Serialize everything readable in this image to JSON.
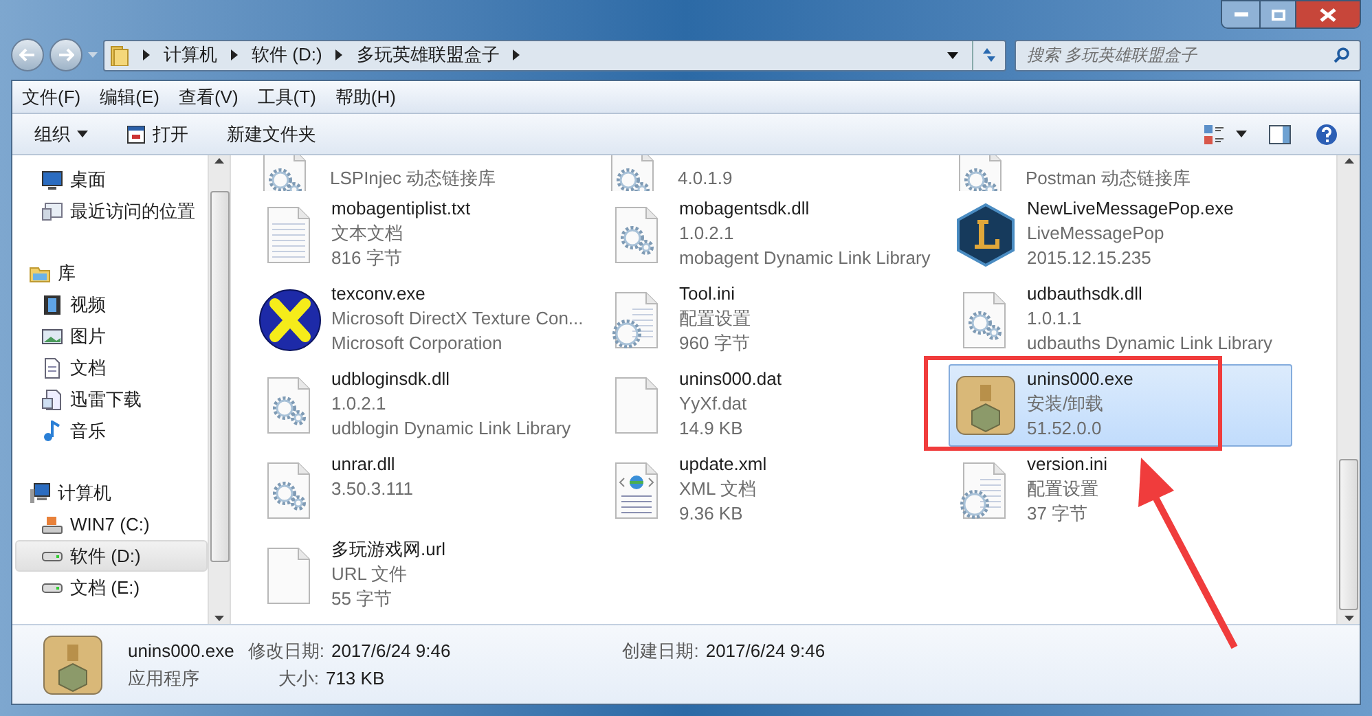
{
  "breadcrumb": [
    "计算机",
    "软件 (D:)",
    "多玩英雄联盟盒子"
  ],
  "search": {
    "placeholder": "搜索 多玩英雄联盟盒子"
  },
  "menu": [
    "文件(F)",
    "编辑(E)",
    "查看(V)",
    "工具(T)",
    "帮助(H)"
  ],
  "toolbar": [
    {
      "label": "组织",
      "kind": "dropdown"
    },
    {
      "label": "打开",
      "kind": "icon"
    },
    {
      "label": "新建文件夹",
      "kind": "plain"
    }
  ],
  "nav": [
    {
      "children": [
        {
          "label": "桌面",
          "kind": "desktop",
          "selected": false
        },
        {
          "label": "最近访问的位置",
          "kind": "recent",
          "selected": false
        }
      ]
    },
    {
      "label": "库",
      "kind": "library",
      "children": [
        {
          "label": "视频",
          "kind": "video",
          "selected": false
        },
        {
          "label": "图片",
          "kind": "picture",
          "selected": false
        },
        {
          "label": "文档",
          "kind": "document",
          "selected": false
        },
        {
          "label": "迅雷下载",
          "kind": "download",
          "selected": false
        },
        {
          "label": "音乐",
          "kind": "music",
          "selected": false
        }
      ]
    },
    {
      "label": "计算机",
      "kind": "computer",
      "children": [
        {
          "label": "WIN7 (C:)",
          "kind": "sysdrive",
          "selected": false
        },
        {
          "label": "软件 (D:)",
          "kind": "drive",
          "selected": true
        },
        {
          "label": "文档 (E:)",
          "kind": "drive",
          "selected": false
        }
      ]
    }
  ],
  "partial_row": [
    {
      "kind": "gear-doc",
      "lines": [
        "LSPInjec 动态链接库"
      ]
    },
    {
      "kind": "gear-doc",
      "lines": [
        "4.0.1.9"
      ]
    },
    {
      "kind": "gear-doc",
      "lines": [
        "Postman 动态链接库"
      ]
    }
  ],
  "files": [
    {
      "kind": "text-doc",
      "name": "mobagentiplist.txt",
      "lines": [
        "文本文档",
        "816 字节"
      ],
      "selected": false
    },
    {
      "kind": "gear-doc",
      "name": "mobagentsdk.dll",
      "lines": [
        "1.0.2.1",
        "mobagent Dynamic Link Library"
      ],
      "selected": false
    },
    {
      "kind": "hex-logo",
      "name": "NewLiveMessagePop.exe",
      "lines": [
        "LiveMessagePop",
        "2015.12.15.235"
      ],
      "selected": false
    },
    {
      "kind": "x-logo",
      "name": "texconv.exe",
      "lines": [
        "Microsoft DirectX Texture Con...",
        "Microsoft Corporation"
      ],
      "selected": false
    },
    {
      "kind": "config",
      "name": "Tool.ini",
      "lines": [
        "配置设置",
        "960 字节"
      ],
      "selected": false
    },
    {
      "kind": "gear-doc",
      "name": "udbauthsdk.dll",
      "lines": [
        "1.0.1.1",
        "udbauths Dynamic Link Library"
      ],
      "selected": false
    },
    {
      "kind": "gear-doc",
      "name": "udbloginsdk.dll",
      "lines": [
        "1.0.2.1",
        "udblogin Dynamic Link Library"
      ],
      "selected": false
    },
    {
      "kind": "blank",
      "name": "unins000.dat",
      "lines": [
        "YyXf.dat",
        "14.9 KB"
      ],
      "selected": false
    },
    {
      "kind": "box",
      "name": "unins000.exe",
      "lines": [
        "安装/卸载",
        "51.52.0.0"
      ],
      "selected": true
    },
    {
      "kind": "gear-doc",
      "name": "unrar.dll",
      "lines": [
        "3.50.3.111"
      ],
      "selected": false
    },
    {
      "kind": "xml",
      "name": "update.xml",
      "lines": [
        "XML 文档",
        "9.36 KB"
      ],
      "selected": false
    },
    {
      "kind": "config",
      "name": "version.ini",
      "lines": [
        "配置设置",
        "37 字节"
      ],
      "selected": false
    },
    {
      "kind": "blank",
      "name": "多玩游戏网.url",
      "lines": [
        "URL 文件",
        "55 字节"
      ],
      "selected": false
    }
  ],
  "details": {
    "name": "unins000.exe",
    "type": "应用程序",
    "fields": [
      {
        "label": "修改日期:",
        "value": "2017/6/24 9:46"
      },
      {
        "label": "创建日期:",
        "value": "2017/6/24 9:46"
      },
      {
        "label": "大小:",
        "value": "713 KB"
      }
    ]
  }
}
